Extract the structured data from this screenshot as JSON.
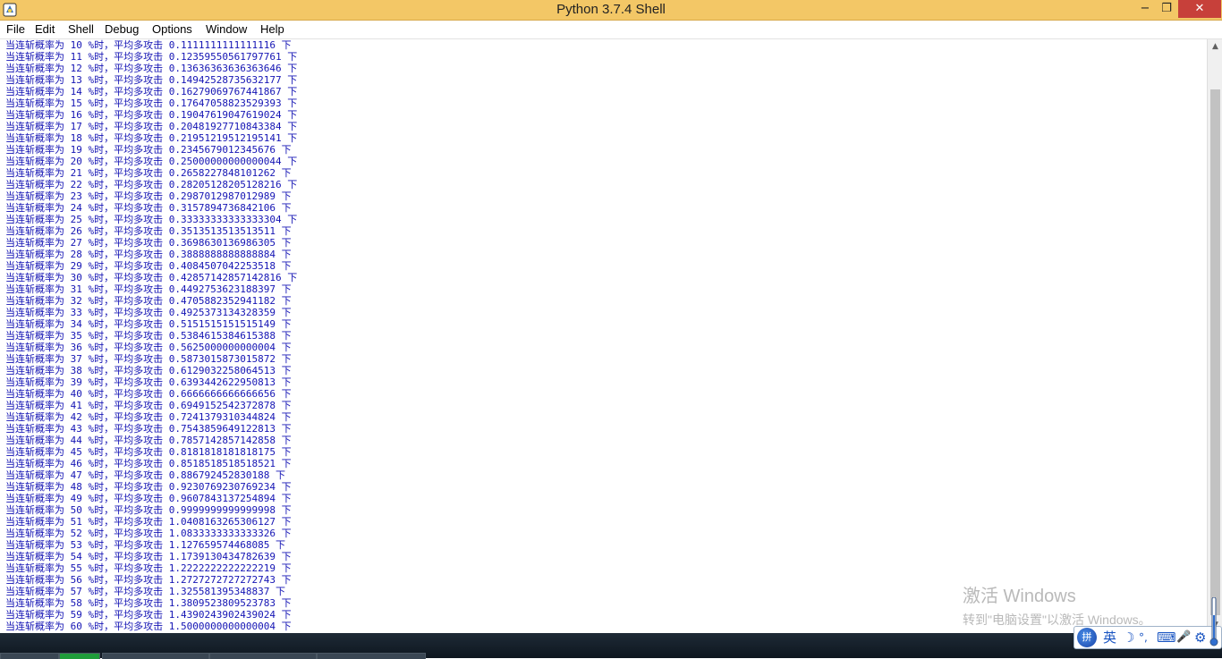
{
  "window": {
    "title": "Python 3.7.4 Shell",
    "minimize_glyph": "−",
    "maximize_glyph": "❐",
    "close_glyph": "✕"
  },
  "menu": [
    "File",
    "Edit",
    "Shell",
    "Debug",
    "Options",
    "Window",
    "Help"
  ],
  "output": {
    "prefix": "当连斩概率为",
    "percent_suffix": "%时，平均多攻击",
    "unit": "下",
    "rows": [
      {
        "p": "10",
        "v": "0.1111111111111116"
      },
      {
        "p": "11",
        "v": "0.12359550561797761"
      },
      {
        "p": "12",
        "v": "0.13636363636363646"
      },
      {
        "p": "13",
        "v": "0.14942528735632177"
      },
      {
        "p": "14",
        "v": "0.16279069767441867"
      },
      {
        "p": "15",
        "v": "0.17647058823529393"
      },
      {
        "p": "16",
        "v": "0.19047619047619024"
      },
      {
        "p": "17",
        "v": "0.20481927710843384"
      },
      {
        "p": "18",
        "v": "0.21951219512195141"
      },
      {
        "p": "19",
        "v": "0.2345679012345676"
      },
      {
        "p": "20",
        "v": "0.25000000000000044"
      },
      {
        "p": "21",
        "v": "0.2658227848101262"
      },
      {
        "p": "22",
        "v": "0.28205128205128216"
      },
      {
        "p": "23",
        "v": "0.2987012987012989"
      },
      {
        "p": "24",
        "v": "0.3157894736842106"
      },
      {
        "p": "25",
        "v": "0.33333333333333304"
      },
      {
        "p": "26",
        "v": "0.3513513513513511"
      },
      {
        "p": "27",
        "v": "0.3698630136986305"
      },
      {
        "p": "28",
        "v": "0.3888888888888884"
      },
      {
        "p": "29",
        "v": "0.4084507042253518"
      },
      {
        "p": "30",
        "v": "0.42857142857142816"
      },
      {
        "p": "31",
        "v": "0.4492753623188397"
      },
      {
        "p": "32",
        "v": "0.4705882352941182"
      },
      {
        "p": "33",
        "v": "0.4925373134328359"
      },
      {
        "p": "34",
        "v": "0.5151515151515149"
      },
      {
        "p": "35",
        "v": "0.5384615384615388"
      },
      {
        "p": "36",
        "v": "0.5625000000000004"
      },
      {
        "p": "37",
        "v": "0.5873015873015872"
      },
      {
        "p": "38",
        "v": "0.6129032258064513"
      },
      {
        "p": "39",
        "v": "0.6393442622950813"
      },
      {
        "p": "40",
        "v": "0.6666666666666656"
      },
      {
        "p": "41",
        "v": "0.6949152542372878"
      },
      {
        "p": "42",
        "v": "0.7241379310344824"
      },
      {
        "p": "43",
        "v": "0.7543859649122813"
      },
      {
        "p": "44",
        "v": "0.7857142857142858"
      },
      {
        "p": "45",
        "v": "0.8181818181818175"
      },
      {
        "p": "46",
        "v": "0.8518518518518521"
      },
      {
        "p": "47",
        "v": "0.886792452830188"
      },
      {
        "p": "48",
        "v": "0.9230769230769234"
      },
      {
        "p": "49",
        "v": "0.9607843137254894"
      },
      {
        "p": "50",
        "v": "0.9999999999999998"
      },
      {
        "p": "51",
        "v": "1.0408163265306127"
      },
      {
        "p": "52",
        "v": "1.0833333333333326"
      },
      {
        "p": "53",
        "v": "1.127659574468085"
      },
      {
        "p": "54",
        "v": "1.1739130434782639"
      },
      {
        "p": "55",
        "v": "1.2222222222222219"
      },
      {
        "p": "56",
        "v": "1.2727272727272743"
      },
      {
        "p": "57",
        "v": "1.325581395348837"
      },
      {
        "p": "58",
        "v": "1.3809523809523783"
      },
      {
        "p": "59",
        "v": "1.4390243902439024"
      },
      {
        "p": "60",
        "v": "1.5000000000000004"
      }
    ]
  },
  "watermark": {
    "title": "激活 Windows",
    "subtitle": "转到\"电脑设置\"以激活 Windows。"
  },
  "ime": {
    "badge": "拼",
    "language": "英",
    "moon_icon": "☽",
    "punct": "°,",
    "keyboard_icon": "⌨",
    "mic_icon": "🎤",
    "settings_icon": "⚙"
  },
  "colors": {
    "titlebar": "#f3c766",
    "output_text": "#1414b4",
    "close_button": "#c7403a"
  }
}
